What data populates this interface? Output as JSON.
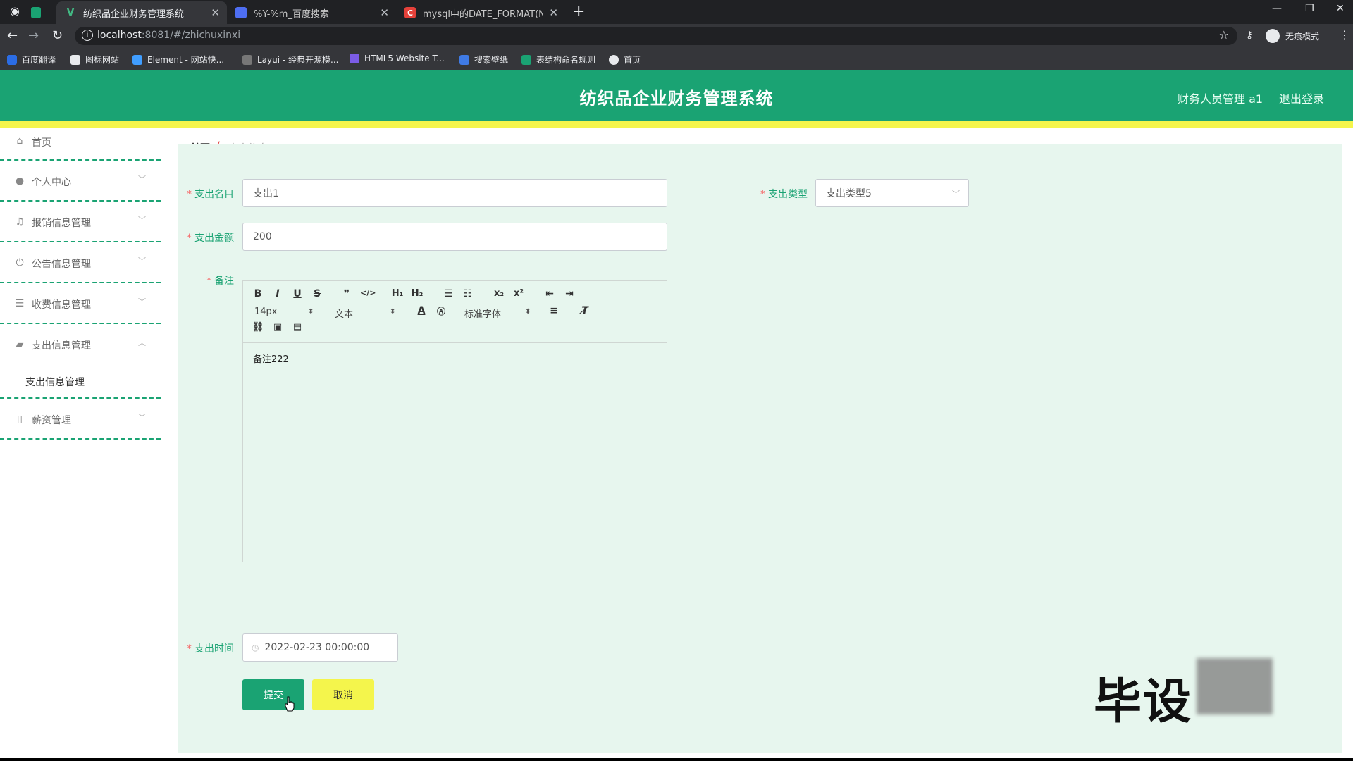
{
  "browser": {
    "tabs": [
      {
        "title": "纺织品企业财务管理系统",
        "active": true
      },
      {
        "title": "%Y-%m_百度搜索",
        "active": false
      },
      {
        "title": "mysql中的DATE_FORMAT(NO",
        "active": false
      }
    ],
    "url_host": "localhost",
    "url_path": ":8081/#/zhichuxinxi",
    "profile_label": "无痕模式",
    "bookmarks": [
      "百度翻译",
      "图标网站",
      "Element - 网站快...",
      "Layui - 经典开源模...",
      "HTML5 Website T...",
      "搜索壁纸",
      "表结构命名规则",
      "首页"
    ]
  },
  "header": {
    "title": "纺织品企业财务管理系统",
    "user": "财务人员管理 a1",
    "logout": "退出登录"
  },
  "sidebar": {
    "items": [
      {
        "label": "首页",
        "icon": "home-icon"
      },
      {
        "label": "个人中心",
        "icon": "user-icon"
      },
      {
        "label": "报销信息管理",
        "icon": "bell-icon"
      },
      {
        "label": "公告信息管理",
        "icon": "power-icon"
      },
      {
        "label": "收费信息管理",
        "icon": "list-icon"
      },
      {
        "label": "支出信息管理",
        "icon": "briefcase-icon"
      },
      {
        "label": "薪资管理",
        "icon": "mic-icon"
      }
    ],
    "submenu": "支出信息管理"
  },
  "breadcrumb": {
    "home": "首页",
    "separator": "/",
    "current": "支出信息"
  },
  "form": {
    "name_label": "支出名目",
    "name_value": "支出1",
    "type_label": "支出类型",
    "type_value": "支出类型5",
    "amount_label": "支出金额",
    "amount_value": "200",
    "remark_label": "备注",
    "remark_content": "备注222",
    "time_label": "支出时间",
    "time_value": "2022-02-23 00:00:00",
    "submit": "提交",
    "cancel": "取消"
  },
  "editor": {
    "font_size": "14px",
    "heading": "文本",
    "font_family": "标准字体"
  },
  "watermark": "毕设",
  "colors": {
    "primary": "#1aa373",
    "accent": "#f4f54c",
    "content_bg": "#e7f6ee"
  }
}
